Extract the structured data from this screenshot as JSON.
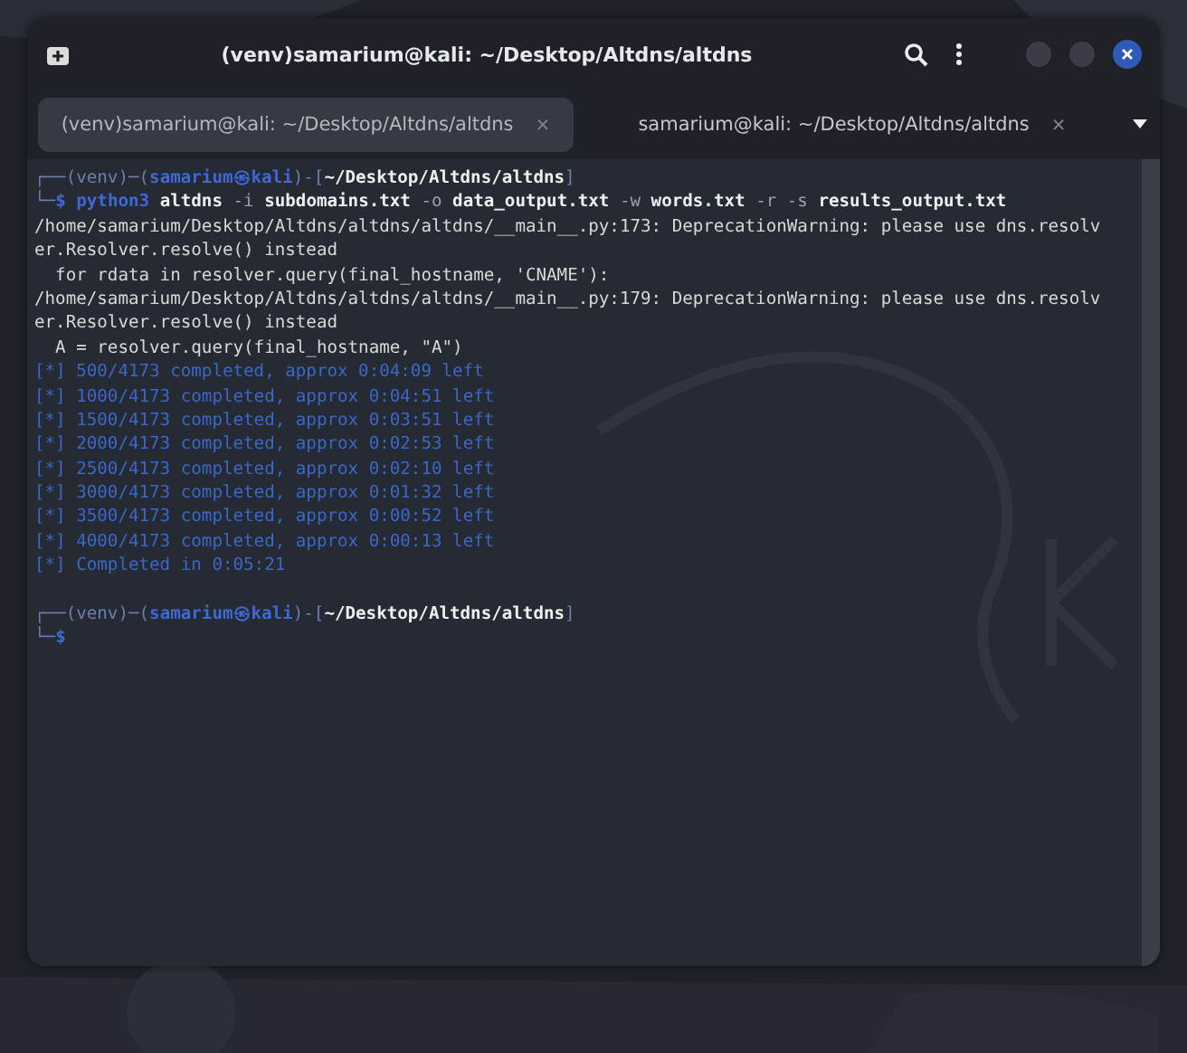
{
  "window": {
    "title": "(venv)samarium@kali: ~/Desktop/Altdns/altdns"
  },
  "tabs": [
    {
      "label": "(venv)samarium@kali: ~/Desktop/Altdns/altdns",
      "selected": true,
      "close": "×"
    },
    {
      "label": "samarium@kali: ~/Desktop/Altdns/altdns",
      "selected": false,
      "close": "×"
    }
  ],
  "terminal": {
    "lines": [
      [
        {
          "kind": "frame",
          "text": "┌──(venv)─("
        },
        {
          "kind": "user",
          "text": "samarium㉿kali"
        },
        {
          "kind": "frame",
          "text": ")-["
        },
        {
          "kind": "path",
          "text": "~/Desktop/Altdns/altdns"
        },
        {
          "kind": "frame",
          "text": "]"
        }
      ],
      [
        {
          "kind": "frame",
          "text": "└─"
        },
        {
          "kind": "user",
          "text": "$ python3"
        },
        {
          "kind": "arg",
          "text": " altdns"
        },
        {
          "kind": "flag",
          "text": " -i"
        },
        {
          "kind": "arg",
          "text": " subdomains.txt"
        },
        {
          "kind": "flag",
          "text": " -o"
        },
        {
          "kind": "arg",
          "text": " data_output.txt"
        },
        {
          "kind": "flag",
          "text": " -w"
        },
        {
          "kind": "arg",
          "text": " words.txt"
        },
        {
          "kind": "flag",
          "text": " -r -s"
        },
        {
          "kind": "arg",
          "text": " results_output.txt"
        }
      ],
      [
        {
          "kind": "plain",
          "text": "/home/samarium/Desktop/Altdns/altdns/altdns/__main__.py:173: DeprecationWarning: please use dns.resolv"
        }
      ],
      [
        {
          "kind": "plain",
          "text": "er.Resolver.resolve() instead"
        }
      ],
      [
        {
          "kind": "plain",
          "text": "  for rdata in resolver.query(final_hostname, 'CNAME'):"
        }
      ],
      [
        {
          "kind": "plain",
          "text": "/home/samarium/Desktop/Altdns/altdns/altdns/__main__.py:179: DeprecationWarning: please use dns.resolv"
        }
      ],
      [
        {
          "kind": "plain",
          "text": "er.Resolver.resolve() instead"
        }
      ],
      [
        {
          "kind": "plain",
          "text": "  A = resolver.query(final_hostname, \"A\")"
        }
      ],
      [
        {
          "kind": "progress",
          "text": "[*] 500/4173 completed, approx 0:04:09 left"
        }
      ],
      [
        {
          "kind": "progress",
          "text": "[*] 1000/4173 completed, approx 0:04:51 left"
        }
      ],
      [
        {
          "kind": "progress",
          "text": "[*] 1500/4173 completed, approx 0:03:51 left"
        }
      ],
      [
        {
          "kind": "progress",
          "text": "[*] 2000/4173 completed, approx 0:02:53 left"
        }
      ],
      [
        {
          "kind": "progress",
          "text": "[*] 2500/4173 completed, approx 0:02:10 left"
        }
      ],
      [
        {
          "kind": "progress",
          "text": "[*] 3000/4173 completed, approx 0:01:32 left"
        }
      ],
      [
        {
          "kind": "progress",
          "text": "[*] 3500/4173 completed, approx 0:00:52 left"
        }
      ],
      [
        {
          "kind": "progress",
          "text": "[*] 4000/4173 completed, approx 0:00:13 left"
        }
      ],
      [
        {
          "kind": "progress",
          "text": "[*] Completed in 0:05:21"
        }
      ],
      {
        "blank_before": true,
        "segments": [
          {
            "kind": "frame",
            "text": "┌──(venv)─("
          },
          {
            "kind": "user",
            "text": "samarium㉿kali"
          },
          {
            "kind": "frame",
            "text": ")-["
          },
          {
            "kind": "path",
            "text": "~/Desktop/Altdns/altdns"
          },
          {
            "kind": "frame",
            "text": "]"
          }
        ]
      },
      [
        {
          "kind": "frame",
          "text": "└─"
        },
        {
          "kind": "user",
          "text": "$"
        }
      ]
    ]
  }
}
